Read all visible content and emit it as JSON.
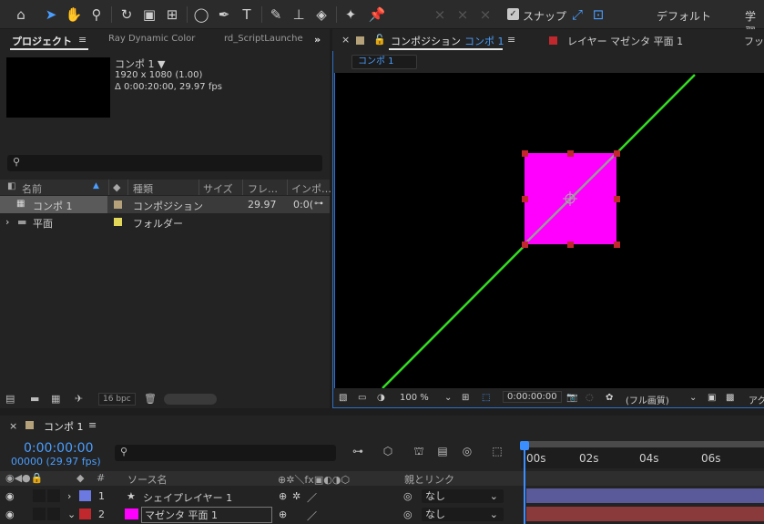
{
  "toolbar": {
    "icons": [
      "home-icon",
      "selection-tool-icon",
      "hand-tool-icon",
      "zoom-tool-icon",
      "rotate-tool-icon",
      "camera-tool-icon",
      "pan-behind-icon",
      "ellipse-tool-icon",
      "pen-tool-icon",
      "text-tool-icon",
      "brush-tool-icon",
      "clone-stamp-icon",
      "eraser-icon",
      "roto-brush-icon",
      "puppet-pin-icon"
    ],
    "snap_label": "スナップ",
    "workspace_default": "デフォルト",
    "workspace_learn": "学習"
  },
  "project_panel": {
    "tabs": [
      "プロジェクト",
      "Ray Dynamic Color",
      "rd_ScriptLaunche"
    ],
    "more_icon": "»",
    "comp_name": "コンポ 1 ▼",
    "comp_size": "1920 x 1080 (1.00)",
    "comp_duration": "Δ 0:00:20:00, 29.97 fps",
    "columns": [
      "名前",
      "種類",
      "サイズ",
      "フレ…",
      "インポ…"
    ],
    "rows": [
      {
        "name": "コンポ 1",
        "type": "コンポジション",
        "size": "",
        "frame": "29.97",
        "inpoint": "0:0(",
        "color": "#b5a17a",
        "selected": true
      },
      {
        "name": "平面",
        "type": "フォルダー",
        "size": "",
        "frame": "",
        "inpoint": "",
        "color": "#e3d75a",
        "selected": false
      }
    ],
    "bpc": "16 bpc"
  },
  "comp_panel": {
    "tab_label": "コンポジション",
    "tab_comp": "コンポ 1",
    "layer_tab": "レイヤー マゼンタ 平面 1",
    "footage_tab": "フッ",
    "sub_tab": "コンポ 1",
    "zoom": "100 %",
    "timecode": "0:00:00:00",
    "quality": "(フル画質)",
    "right_label": "アク"
  },
  "timeline": {
    "tab": "コンポ 1",
    "timecode": "0:00:00:00",
    "fps": "00000 (29.97 fps)",
    "ruler": [
      "00s",
      "02s",
      "04s",
      "06s"
    ],
    "col_source": "ソース名",
    "col_parent": "親とリンク",
    "col_num": "#",
    "layers": [
      {
        "num": "1",
        "name": "シェイプレイヤー 1",
        "parent": "なし",
        "label_color": "#6b79e0",
        "track_color": "#5a5a9a",
        "expanded": false
      },
      {
        "num": "2",
        "name": "マゼンタ 平面 1",
        "parent": "なし",
        "label_color": "#c0282e",
        "track_color": "#8a3a3a",
        "expanded": true
      }
    ]
  },
  "colors": {
    "accent": "#4a9eff",
    "magenta": "#ff00ff",
    "line_green": "#33dd22"
  }
}
